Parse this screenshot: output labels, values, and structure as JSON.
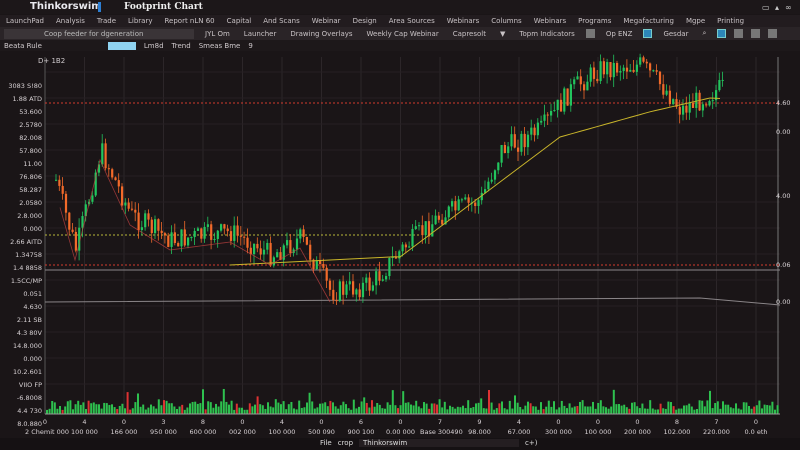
{
  "app": {
    "name": "Thinkorswim",
    "title": "Footprint Chart"
  },
  "menu": [
    "LaunchPad",
    "Analysis",
    "Trade",
    "Library",
    "Report nLN 60",
    "Capital",
    "And Scans",
    "Webinar",
    "Design",
    "Area Sources",
    "Webinars",
    "Columns",
    "Webinars",
    "Programs",
    "Megafacturing",
    "Mgpe",
    "Printing"
  ],
  "toolbar": {
    "search_placeholder": "Coop feeder for dgeneration",
    "search_value": "JYL Om",
    "items": [
      "Launcher",
      "Drawing Overlays",
      "Weekly Cap Webinar",
      "Capresolt",
      "Topm Indicators",
      "Op ENZ",
      "Gesdar"
    ]
  },
  "toolbar2": {
    "label": "Beata Rule",
    "field": "Lm8d",
    "trend": "Trend",
    "studies": "Smeas Bme",
    "num": "9"
  },
  "chart": {
    "symbol": "D+ 1B2",
    "y_axis": [
      "3083 S!80",
      "1.88 ATD",
      "53.600",
      "2.5780",
      "82.008",
      "57.800",
      "11.00",
      "76.806",
      "58.287",
      "2.0580",
      "2.8.000",
      "0.000",
      "2.66 AITD",
      "1.34758",
      "1.4 8858",
      "1.5CC/MP",
      "0.051",
      "4.630",
      "2.11 SB",
      "4.3 80V",
      "14.8.000",
      "0.000",
      "10.2.601",
      "VIIO FP",
      "-6.8008",
      "4.4 730",
      "8.0.880"
    ],
    "right_axis": [
      "4.60",
      "0.00",
      "4.00",
      "0.06",
      "0.00"
    ],
    "x_ticks": [
      "0",
      "4",
      "0",
      "3",
      "8",
      "0",
      "4",
      "0",
      "6",
      "0",
      "7",
      "9",
      "4",
      "0",
      "0",
      "0",
      "8",
      "7",
      "0"
    ],
    "x_labels": [
      "2 Chemit 000",
      "100 000",
      "166 000",
      "950 000",
      "600 000",
      "002 000",
      "100 000",
      "500 090",
      "900 100",
      "0.00 000",
      "Base 300490",
      "98.000",
      "67.000",
      "300 000",
      "100 000",
      "200 000",
      "102.000",
      "220.000",
      "0.0 eth"
    ],
    "colors": {
      "up": "#22c55e",
      "down": "#f26a2a",
      "ma": "#c9b52a",
      "red_line": "#d23a2e",
      "yellow_line": "#b8b83a"
    }
  },
  "status": {
    "file": "File",
    "crop": "crop",
    "app": "Thinkorswim",
    "icons": "c+)"
  }
}
